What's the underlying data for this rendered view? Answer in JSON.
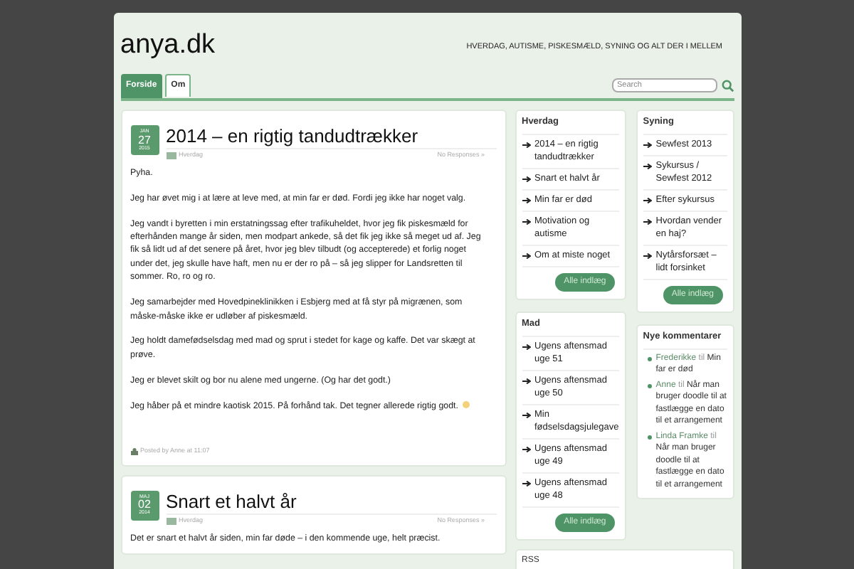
{
  "site": {
    "title": "anya.dk",
    "tagline": "HVERDAG, AUTISME, PISKESMÆLD, SYNING OG ALT DER I MELLEM"
  },
  "nav": [
    {
      "label": "Forside",
      "selected": true
    },
    {
      "label": "Om",
      "selected": false
    }
  ],
  "search": {
    "placeholder": "Search"
  },
  "posts": [
    {
      "month": "JAN",
      "day": "27",
      "year": "2015",
      "title": "2014 – en rigtig tandudtrækker",
      "category": "Hverdag",
      "responses": "No Responses »",
      "paragraphs": [
        "Pyha.",
        "Jeg har øvet mig i at lære at leve med, at min far er død. Fordi jeg ikke har noget valg.",
        "Jeg vandt i byretten i min erstatningssag efter trafikuheldet, hvor jeg fik piskesmæld for efterhånden mange år siden, men modpart ankede, så det fik jeg ikke så meget ud af. Jeg fik så lidt ud af det senere på året, hvor jeg blev tilbudt (og accepterede) et forlig noget under det, jeg skulle have haft, men nu er der ro på – så jeg slipper for Landsretten til sommer. Ro, ro og ro.",
        "Jeg samarbejder med Hovedpineklinikken i Esbjerg med at få styr på migrænen, som måske-måske ikke er udløber af piskesmæld.",
        "Jeg holdt damefødselsdag med mad og sprut i stedet for kage og kaffe. Det var skægt at prøve.",
        "Jeg er blevet skilt og bor nu alene med ungerne. (Og har det godt.)",
        "Jeg håber på et mindre kaotisk 2015. På forhånd tak.   Det tegner allerede rigtig godt."
      ],
      "smiley": true,
      "byline": "Posted by Anne at 11:07"
    },
    {
      "month": "MAJ",
      "day": "02",
      "year": "2014",
      "title": "Snart et halvt år",
      "category": "Hverdag",
      "responses": "No Responses »",
      "paragraphs": [
        "Det er snart et halvt år siden, min far døde – i den kommende uge, helt præcist."
      ],
      "smiley": false
    }
  ],
  "sidebar": {
    "columns": [
      [
        {
          "kind": "links",
          "title": "Hverdag",
          "items": [
            "2014 – en rigtig tandudtrækker",
            "Snart et halvt år",
            "Min far er død",
            "Motivation og autisme",
            "Om at miste noget"
          ],
          "button": "Alle indlæg"
        },
        {
          "kind": "links",
          "title": "Mad",
          "items": [
            "Ugens aftensmad uge 51",
            "Ugens aftensmad uge 50",
            "Min fødselsdagsjulegave",
            "Ugens aftensmad uge 49",
            "Ugens aftensmad uge 48"
          ],
          "button": "Alle indlæg"
        }
      ],
      [
        {
          "kind": "links",
          "title": "Syning",
          "items": [
            "Sewfest 2013",
            "Sykursus / Sewfest 2012",
            "Efter sykursus",
            "Hvordan vender en haj?",
            "Nytårsforsæt – lidt forsinket"
          ],
          "button": "Alle indlæg"
        },
        {
          "kind": "comments",
          "title": "Nye kommentarer",
          "items": [
            {
              "author": "Frederikke",
              "joiner": "til",
              "post": "Min far er død"
            },
            {
              "author": "Anne",
              "joiner": "til",
              "post": "Når man bruger doodle til at fastlægge en dato til et arrangement"
            },
            {
              "author": "Linda Framke",
              "joiner": "til",
              "post": "Når man bruger doodle til at fastlægge en dato til et arrangement"
            }
          ]
        }
      ]
    ],
    "bottom": {
      "title": "RSS"
    }
  }
}
